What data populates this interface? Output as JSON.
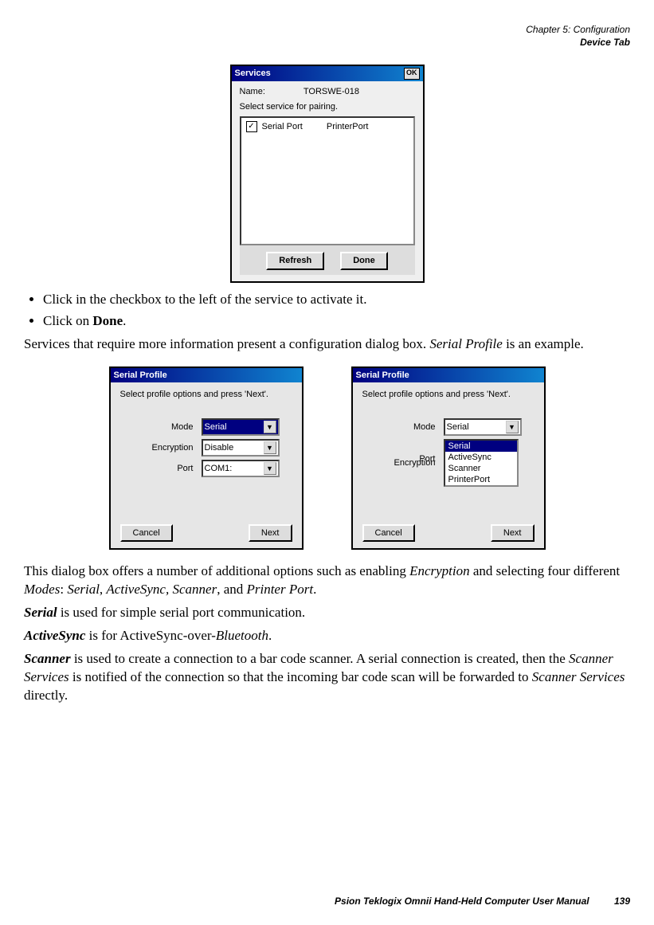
{
  "header": {
    "line1": "Chapter 5:  Configuration",
    "line2": "Device Tab"
  },
  "services_dialog": {
    "title": "Services",
    "ok": "OK",
    "name_label": "Name:",
    "name_value": "TORSWE-018",
    "instruction": "Select service for pairing.",
    "item_name": "Serial Port",
    "item_sub": "PrinterPort",
    "refresh": "Refresh",
    "done": "Done"
  },
  "bullets": {
    "b1": "Click in the checkbox to the left of the service to activate it.",
    "b2_a": "Click on ",
    "b2_b": "Done",
    "b2_c": "."
  },
  "para1_a": "Services that require more information present a configuration dialog box. ",
  "para1_b": "Serial Profile",
  "para1_c": " is an example.",
  "sp": {
    "title": "Serial Profile",
    "instruction": "Select profile options and press 'Next'.",
    "mode_label": "Mode",
    "enc_label": "Encryption",
    "port_label": "Port",
    "mode_val": "Serial",
    "enc_val": "Disable",
    "port_val": "COM1:",
    "opt1": "Serial",
    "opt2": "ActiveSync",
    "opt3": "Scanner",
    "opt4": "PrinterPort",
    "cancel": "Cancel",
    "next": "Next"
  },
  "para2_a": "This dialog box offers a number of additional options such as enabling ",
  "para2_b": "Encryption",
  "para2_c": " and selecting four different ",
  "para2_d": "Modes",
  "para2_e": ": ",
  "para2_f": "Serial",
  "para2_g": ", ",
  "para2_h": "ActiveSync, Scanner",
  "para2_i": ", and ",
  "para2_j": "Printer Port",
  "para2_k": ".",
  "para3_a": "Serial",
  "para3_b": " is used for simple serial port communication.",
  "para4_a": "ActiveSync",
  "para4_b": " is for ActiveSync-over-",
  "para4_c": "Bluetooth",
  "para4_d": ".",
  "para5_a": "Scanner",
  "para5_b": " is used to create a connection to a bar code scanner. A serial connection is created, then the ",
  "para5_c": "Scanner Services",
  "para5_d": " is notified of the connection so that the incoming bar code scan will be forwarded to ",
  "para5_e": "Scanner Services",
  "para5_f": " directly.",
  "footer": {
    "text": "Psion Teklogix Omnii Hand-Held Computer User Manual",
    "page": "139"
  }
}
